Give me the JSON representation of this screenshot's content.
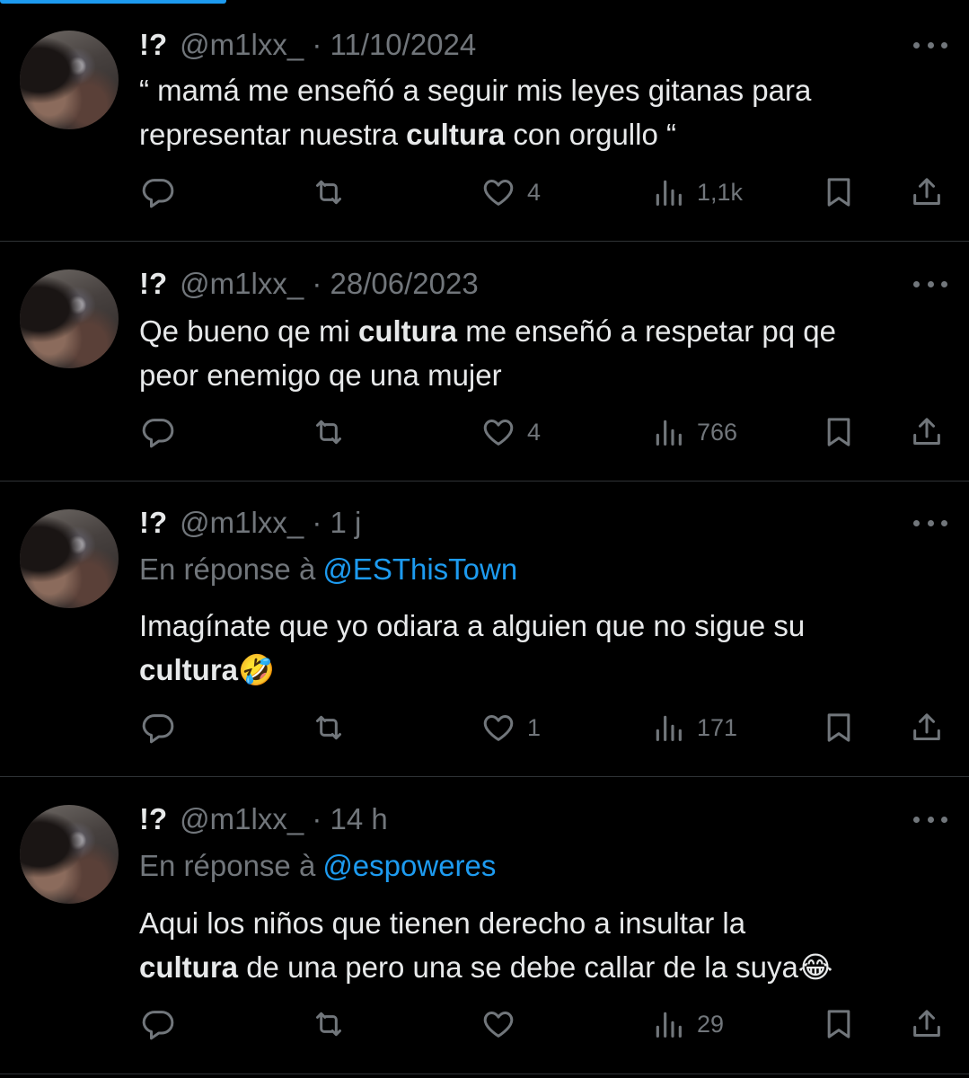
{
  "tweets": [
    {
      "name": "!?",
      "handle": "@m1lxx_",
      "time": "· 11/10/2024",
      "reply_label": "",
      "reply_to": "",
      "text_before": "“ mamá me enseñó a seguir mis leyes gitanas para\nrepresentar nuestra ",
      "text_bold": "cultura",
      "text_after": " con orgullo “",
      "likes": "4",
      "views": "1,1k"
    },
    {
      "name": "!?",
      "handle": "@m1lxx_",
      "time": "· 28/06/2023",
      "reply_label": "",
      "reply_to": "",
      "text_before": "Qe bueno qe mi ",
      "text_bold": "cultura",
      "text_after": " me enseñó a respetar pq qe\npeor enemigo qe una mujer",
      "likes": "4",
      "views": "766"
    },
    {
      "name": "!?",
      "handle": "@m1lxx_",
      "time": "· 1 j",
      "reply_label": "En réponse à",
      "reply_to": "@ESThisTown",
      "text_before": "Imagínate que yo odiara a alguien que no sigue su\n",
      "text_bold": "cultura",
      "text_after": "🤣",
      "likes": "1",
      "views": "171"
    },
    {
      "name": "!?",
      "handle": "@m1lxx_",
      "time": "· 14 h",
      "reply_label": "En réponse à",
      "reply_to": "@espoweres",
      "text_before": "Aqui los niños que tienen derecho a insultar la\n",
      "text_bold": "cultura",
      "text_after": " de una pero una se debe callar de la suya😂",
      "likes": "",
      "views": "29"
    }
  ],
  "icons": {
    "reply": "reply-icon",
    "retweet": "retweet-icon",
    "like": "heart-icon",
    "views": "views-icon",
    "bookmark": "bookmark-icon",
    "share": "share-icon",
    "more": "more-icon"
  },
  "colors": {
    "background": "#000000",
    "text": "#e7e9ea",
    "muted": "#71767b",
    "accent": "#1d9bf0",
    "divider": "#2f3336"
  }
}
